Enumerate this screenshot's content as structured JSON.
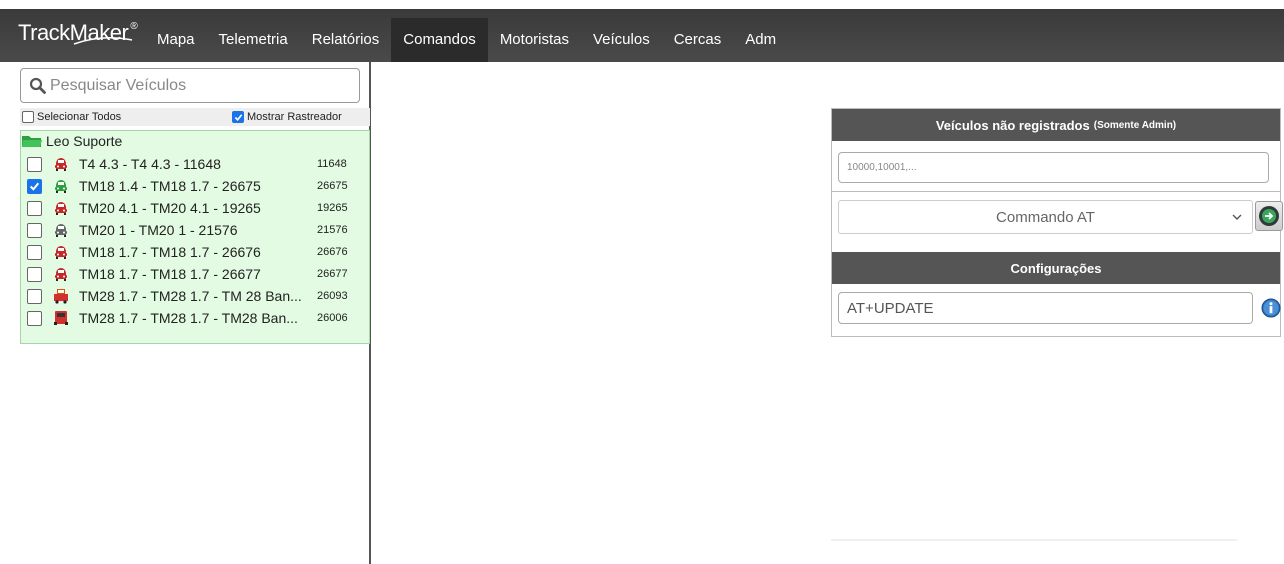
{
  "app": {
    "logo_text": "TrackMaker",
    "logo_mark": "®"
  },
  "nav": {
    "items": [
      {
        "label": "Mapa"
      },
      {
        "label": "Telemetria"
      },
      {
        "label": "Relatórios"
      },
      {
        "label": "Comandos",
        "active": true
      },
      {
        "label": "Motoristas"
      },
      {
        "label": "Veículos"
      },
      {
        "label": "Cercas"
      },
      {
        "label": "Adm"
      }
    ]
  },
  "sidebar": {
    "search_placeholder": "Pesquisar Veículos",
    "select_all_label": "Selecionar Todos",
    "select_all_checked": false,
    "show_tracker_label": "Mostrar Rastreador",
    "show_tracker_checked": true,
    "group_name": "Leo Suporte",
    "vehicles": [
      {
        "name": "T4 4.3 - T4 4.3 - 11648",
        "id": "11648",
        "checked": false,
        "icon": "car-red-icon"
      },
      {
        "name": "TM18 1.4 - TM18 1.7 - 26675",
        "id": "26675",
        "checked": true,
        "icon": "car-green-icon"
      },
      {
        "name": "TM20 4.1 - TM20 4.1 - 19265",
        "id": "19265",
        "checked": false,
        "icon": "car-red-icon"
      },
      {
        "name": "TM20 1 - TM20 1 - 21576",
        "id": "21576",
        "checked": false,
        "icon": "car-gray-icon"
      },
      {
        "name": "TM18 1.7 - TM18 1.7 - 26676",
        "id": "26676",
        "checked": false,
        "icon": "car-red-icon"
      },
      {
        "name": "TM18 1.7 - TM18 1.7 - 26677",
        "id": "26677",
        "checked": false,
        "icon": "car-red-icon"
      },
      {
        "name": "TM28 1.7 - TM28 1.7 - TM 28 Ban...",
        "id": "26093",
        "checked": false,
        "icon": "truck-red-icon"
      },
      {
        "name": "TM28 1.7 - TM28 1.7 - TM28 Ban...",
        "id": "26006",
        "checked": false,
        "icon": "truck-red-front-icon"
      }
    ]
  },
  "right_panel": {
    "unregistered_title": "Veículos não registrados",
    "unregistered_note": "(Somente Admin)",
    "unregistered_placeholder": "10000,10001,...",
    "command_select_value": "Commando AT",
    "config_title": "Configurações",
    "config_value": "AT+UPDATE"
  },
  "colors": {
    "nav_bg": "#444444",
    "tree_bg": "#e2fbe2",
    "accent": "#1a73e8"
  }
}
